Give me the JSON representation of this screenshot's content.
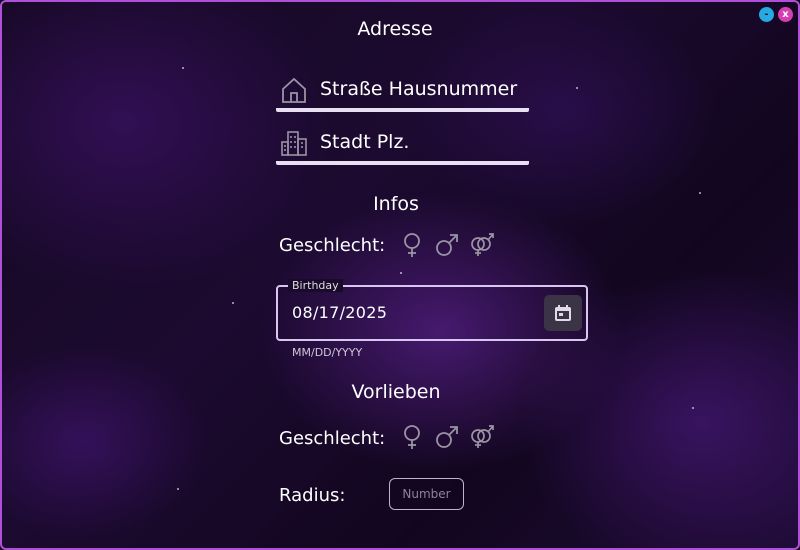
{
  "window": {
    "minimize_label": "-",
    "close_label": "x"
  },
  "address": {
    "title": "Adresse",
    "street": {
      "text": "Straße Hausnummer",
      "icon": "home-icon"
    },
    "city": {
      "text": "Stadt Plz.",
      "icon": "city-icon"
    }
  },
  "infos": {
    "title": "Infos",
    "gender_label": "Geschlecht:",
    "gender_icons": [
      "female-icon",
      "male-icon",
      "gender-both-icon"
    ],
    "birthday": {
      "label": "Birthday",
      "value": "08/17/2025",
      "hint": "MM/DD/YYYY"
    }
  },
  "preferences": {
    "title": "Vorlieben",
    "gender_label": "Geschlecht:",
    "gender_icons": [
      "female-icon",
      "male-icon",
      "gender-both-icon"
    ],
    "radius_label": "Radius:",
    "radius_placeholder": "Number",
    "radius_value": ""
  },
  "colors": {
    "window_border": "#b050d8",
    "minimize": "#27a9e1",
    "close": "#d63fb2",
    "underline": "#e8e0f2",
    "icon_gray": "#9a94a4"
  }
}
